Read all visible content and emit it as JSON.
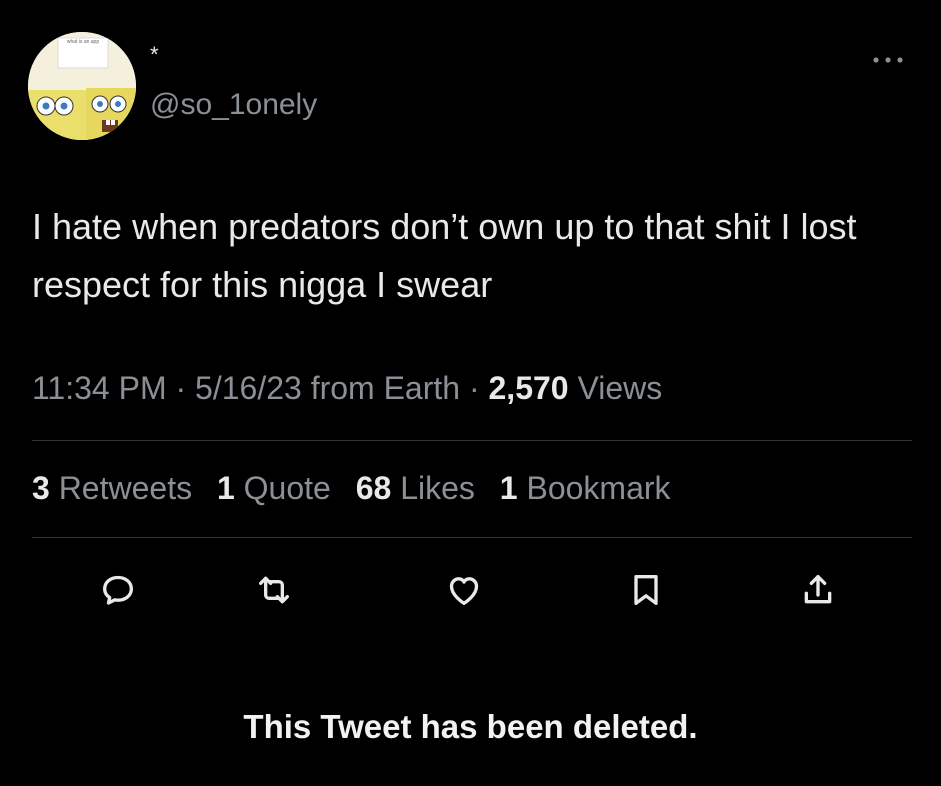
{
  "author": {
    "display_name": "*",
    "handle": "@so_1onely",
    "avatar_caption": "what is an app"
  },
  "tweet": {
    "text": "I hate when predators don’t own up to that shit I lost respect for this nigga I swear"
  },
  "meta": {
    "time": "11:34 PM",
    "sep1": "·",
    "date": "5/16/23",
    "location": "from Earth",
    "sep2": "·",
    "views_count": "2,570",
    "views_label": "Views"
  },
  "stats": [
    {
      "count": "3",
      "label": "Retweets"
    },
    {
      "count": "1",
      "label": "Quote"
    },
    {
      "count": "68",
      "label": "Likes"
    },
    {
      "count": "1",
      "label": "Bookmark"
    }
  ],
  "actions": [
    "reply-icon",
    "retweet-icon",
    "like-icon",
    "bookmark-icon",
    "share-icon"
  ],
  "notice": "This Tweet has been deleted.",
  "colors": {
    "background": "#000000",
    "text": "#e7e9ea",
    "muted": "#8b9096",
    "divider": "#2f3336"
  }
}
